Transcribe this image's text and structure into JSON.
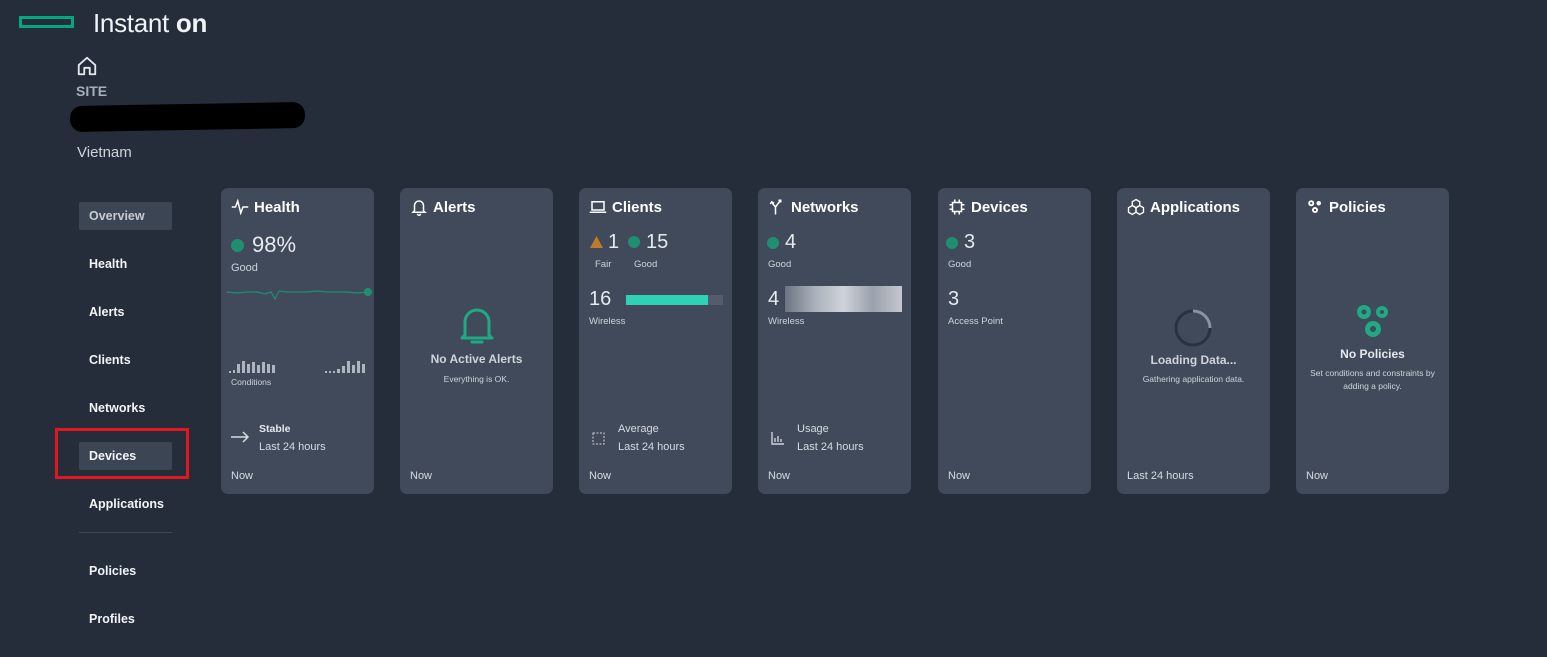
{
  "app": {
    "title": "Instant",
    "title_suffix": "on",
    "brand_color": "#01a982"
  },
  "site": {
    "label": "SITE",
    "country": "Vietnam"
  },
  "nav": {
    "items": [
      "Overview",
      "Health",
      "Alerts",
      "Clients",
      "Networks",
      "Devices",
      "Applications"
    ],
    "items_bottom": [
      "Policies",
      "Profiles"
    ],
    "active": "Overview",
    "highlighted": "Devices"
  },
  "cards": {
    "health": {
      "title": "Health",
      "percent": "98%",
      "status": "Good",
      "conditions_label": "Conditions",
      "trend_title": "Stable",
      "trend_period": "Last 24 hours",
      "now": "Now"
    },
    "alerts": {
      "title": "Alerts",
      "heading": "No Active Alerts",
      "message": "Everything is OK.",
      "now": "Now"
    },
    "clients": {
      "title": "Clients",
      "fair_count": "1",
      "fair_label": "Fair",
      "good_count": "15",
      "good_label": "Good",
      "wireless_count": "16",
      "wireless_label": "Wireless",
      "wireless_fill": 0.85,
      "trend_title": "Average",
      "trend_period": "Last 24 hours",
      "now": "Now"
    },
    "networks": {
      "title": "Networks",
      "good_count": "4",
      "good_label": "Good",
      "wireless_count": "4",
      "wireless_label": "Wireless",
      "trend_title": "Usage",
      "trend_period": "Last 24 hours",
      "now": "Now"
    },
    "devices": {
      "title": "Devices",
      "good_count": "3",
      "good_label": "Good",
      "ap_count": "3",
      "ap_label": "Access Point",
      "now": "Now"
    },
    "applications": {
      "title": "Applications",
      "heading": "Loading Data...",
      "message": "Gathering application data.",
      "period": "Last 24 hours"
    },
    "policies": {
      "title": "Policies",
      "heading": "No Policies",
      "message": "Set conditions and constraints by adding a policy.",
      "now": "Now"
    }
  },
  "colors": {
    "good": "#1f8f71",
    "fair": "#c07a28",
    "accent": "#2ed3b7",
    "highlight": "#e0171c"
  }
}
